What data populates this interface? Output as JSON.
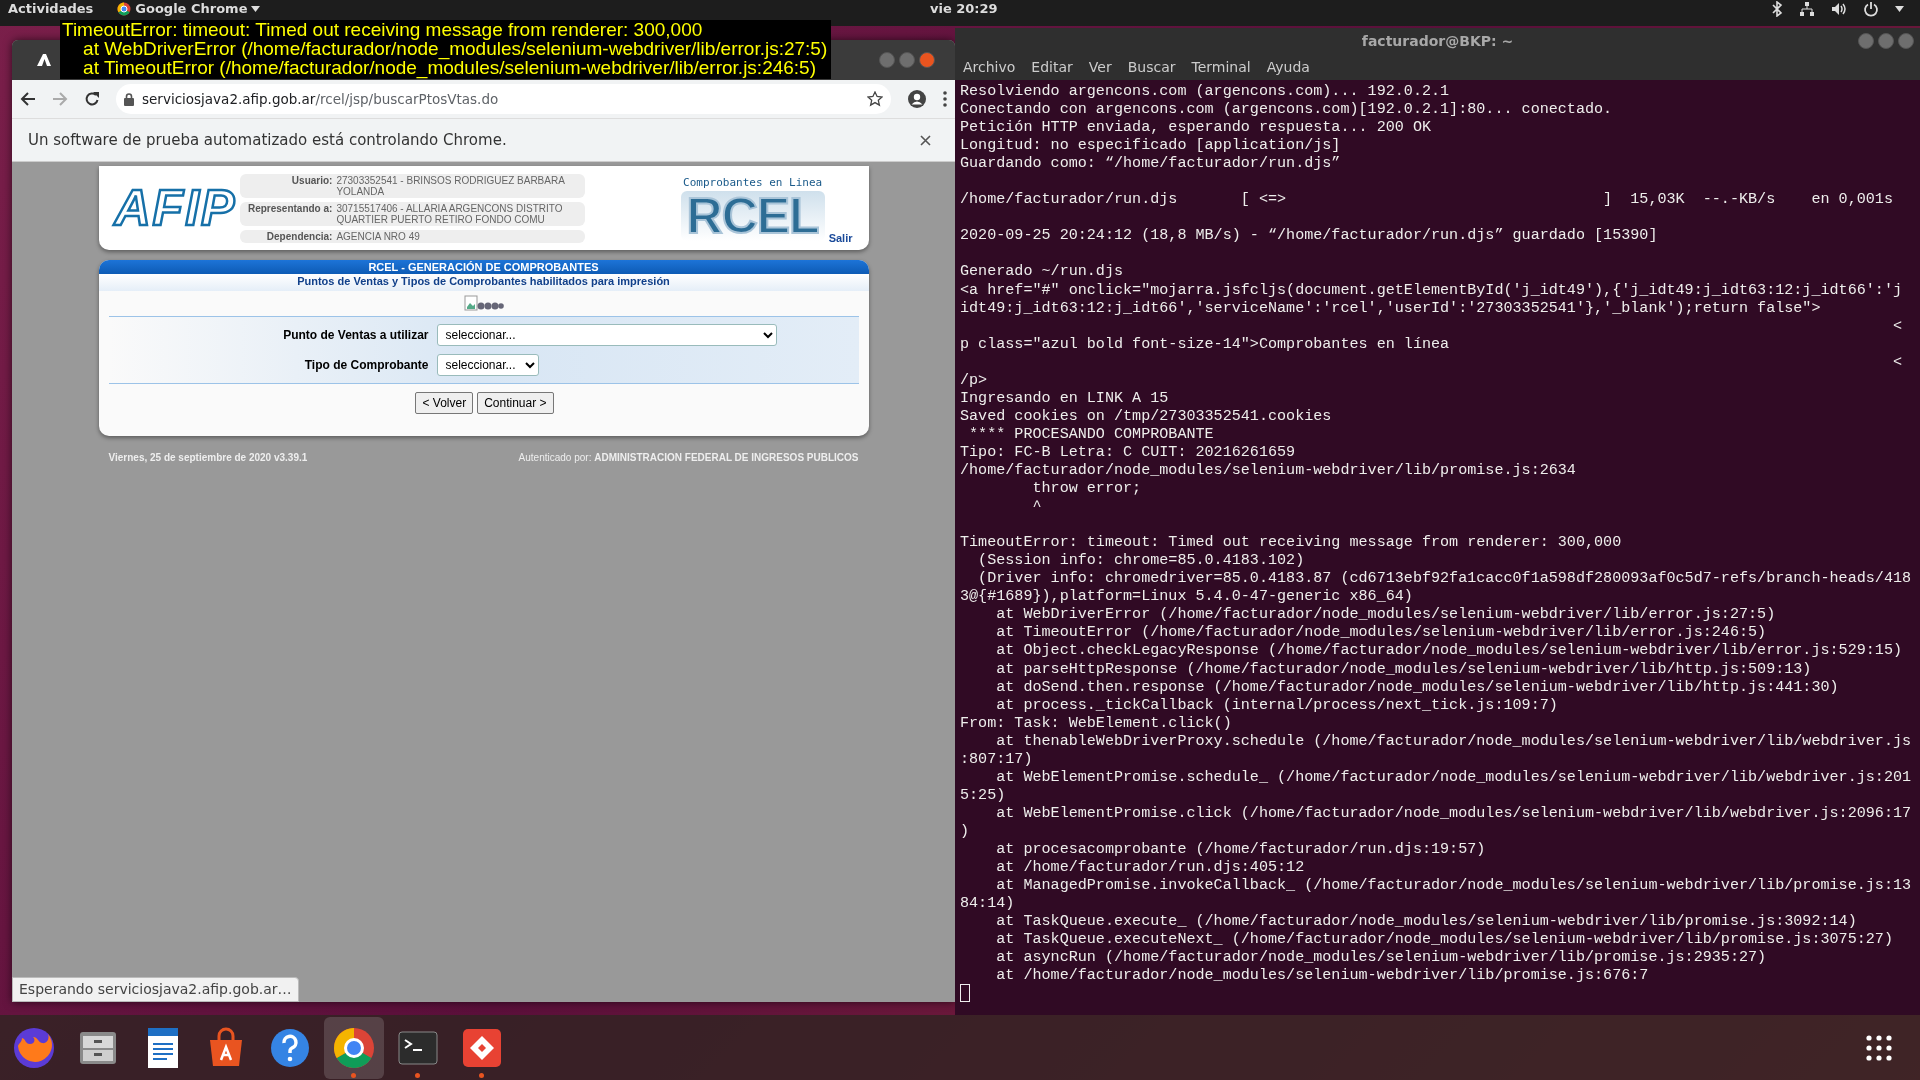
{
  "top_bar": {
    "activities": "Actividades",
    "app_menu": "Google Chrome",
    "clock": "vie 20:29"
  },
  "error_overlay": {
    "lines": [
      "TimeoutError: timeout: Timed out receiving message from renderer: 300,000",
      "    at WebDriverError (/home/facturador/node_modules/selenium-webdriver/lib/error.js:27:5)",
      "    at TimeoutError (/home/facturador/node_modules/selenium-webdriver/lib/error.js:246:5)"
    ]
  },
  "browser": {
    "url_host": "serviciosjava2.afip.gob.ar",
    "url_path": "/rcel/jsp/buscarPtosVtas.do",
    "infobar": "Un software de prueba automatizado está controlando Chrome.",
    "status": "Esperando serviciosjava2.afip.gob.ar…",
    "page": {
      "header": {
        "logo": "AFIP",
        "fields": [
          {
            "label": "Usuario:",
            "value": "27303352541 - BRINSOS RODRIGUEZ BARBARA YOLANDA"
          },
          {
            "label": "Representando a:",
            "value": "30715517406 - ALLARIA ARGENCONS DISTRITO QUARTIER PUERTO RETIRO FONDO COMU"
          },
          {
            "label": "Dependencia:",
            "value": "AGENCIA NRO 49"
          }
        ],
        "rcel_caption": "Comprobantes en Linea",
        "rcel_logo": "RCEL",
        "logout": "Salir"
      },
      "panel": {
        "title": "RCEL - GENERACIÓN DE COMPROBANTES",
        "subtitle": "Puntos de Ventas y Tipos de Comprobantes habilitados para impresión",
        "fields": [
          {
            "label": "Punto de Ventas a utilizar",
            "value": "seleccionar...",
            "kind": "wide"
          },
          {
            "label": "Tipo de Comprobante",
            "value": "seleccionar...",
            "kind": "narrow"
          }
        ],
        "buttons": [
          "< Volver",
          "Continuar >"
        ]
      },
      "footer": {
        "date": "Viernes, 25 de septiembre de 2020 v3.39.1",
        "auth": "Autenticado por: **ADMINISTRACION FEDERAL DE INGRESOS PUBLICOS**"
      }
    }
  },
  "terminal": {
    "title": "facturador@BKP: ~",
    "menu": [
      "Archivo",
      "Editar",
      "Ver",
      "Buscar",
      "Terminal",
      "Ayuda"
    ],
    "blocks": [
      [
        "Resolviendo argencons.com (argencons.com)... 192.0.2.1",
        "Conectando con argencons.com (argencons.com)[192.0.2.1]:80... conectado.",
        "Petición HTTP enviada, esperando respuesta... 200 OK",
        "Longitud: no especificado [application/js]",
        "Guardando como: “/home/facturador/run.djs”"
      ],
      [
        "/home/facturador/run.djs       [ <=>                                   ]  15,03K  --.-KB/s    en 0,001s"
      ],
      [
        "2020-09-25 20:24:12 (18,8 MB/s) - “/home/facturador/run.djs” guardado [15390]"
      ],
      [
        "Generado ~/run.djs",
        "<a href=\"#\" onclick=\"mojarra.jsfcljs(document.getElementById('j_idt49'),{'j_idt49:j_idt63:12:j_idt66':'j",
        "idt49:j_idt63:12:j_idt66','serviceName':'rcel','userId':'27303352541'},'_blank');return false\">",
        "                                                                                                       <",
        "p class=\"azul bold font-size-14\">Comprobantes en línea",
        "                                                                                                       <",
        "/p>",
        "Ingresando en LINK A 15",
        "Saved cookies on /tmp/27303352541.cookies",
        " **** PROCESANDO COMPROBANTE",
        "Tipo: FC-B Letra: C CUIT: 20216261659",
        "/home/facturador/node_modules/selenium-webdriver/lib/promise.js:2634",
        "        throw error;",
        "        ^"
      ],
      [
        "TimeoutError: timeout: Timed out receiving message from renderer: 300,000",
        "  (Session info: chrome=85.0.4183.102)",
        "  (Driver info: chromedriver=85.0.4183.87 (cd6713ebf92fa1cacc0f1a598df280093af0c5d7-refs/branch-heads/418",
        "3@{#1689}),platform=Linux 5.4.0-47-generic x86_64)",
        "    at WebDriverError (/home/facturador/node_modules/selenium-webdriver/lib/error.js:27:5)",
        "    at TimeoutError (/home/facturador/node_modules/selenium-webdriver/lib/error.js:246:5)",
        "    at Object.checkLegacyResponse (/home/facturador/node_modules/selenium-webdriver/lib/error.js:529:15)",
        "    at parseHttpResponse (/home/facturador/node_modules/selenium-webdriver/lib/http.js:509:13)",
        "    at doSend.then.response (/home/facturador/node_modules/selenium-webdriver/lib/http.js:441:30)",
        "    at process._tickCallback (internal/process/next_tick.js:109:7)",
        "From: Task: WebElement.click()",
        "    at thenableWebDriverProxy.schedule (/home/facturador/node_modules/selenium-webdriver/lib/webdriver.js",
        ":807:17)",
        "    at WebElementPromise.schedule_ (/home/facturador/node_modules/selenium-webdriver/lib/webdriver.js:201",
        "5:25)",
        "    at WebElementPromise.click (/home/facturador/node_modules/selenium-webdriver/lib/webdriver.js:2096:17",
        ")",
        "    at procesacomprobante (/home/facturador/run.djs:19:57)",
        "    at /home/facturador/run.djs:405:12",
        "    at ManagedPromise.invokeCallback_ (/home/facturador/node_modules/selenium-webdriver/lib/promise.js:13",
        "84:14)",
        "    at TaskQueue.execute_ (/home/facturador/node_modules/selenium-webdriver/lib/promise.js:3092:14)",
        "    at TaskQueue.executeNext_ (/home/facturador/node_modules/selenium-webdriver/lib/promise.js:3075:27)",
        "    at asyncRun (/home/facturador/node_modules/selenium-webdriver/lib/promise.js:2935:27)",
        "    at /home/facturador/node_modules/selenium-webdriver/lib/promise.js:676:7"
      ]
    ]
  },
  "dock": {
    "items": [
      {
        "kind": "firefox",
        "running": false,
        "selected": false
      },
      {
        "kind": "files",
        "running": false,
        "selected": false
      },
      {
        "kind": "writer",
        "running": false,
        "selected": false
      },
      {
        "kind": "software",
        "running": false,
        "selected": false
      },
      {
        "kind": "help",
        "running": false,
        "selected": false
      },
      {
        "kind": "chrome",
        "running": true,
        "selected": true
      },
      {
        "kind": "terminal",
        "running": true,
        "selected": false
      },
      {
        "kind": "diamond",
        "running": true,
        "selected": false
      }
    ]
  }
}
